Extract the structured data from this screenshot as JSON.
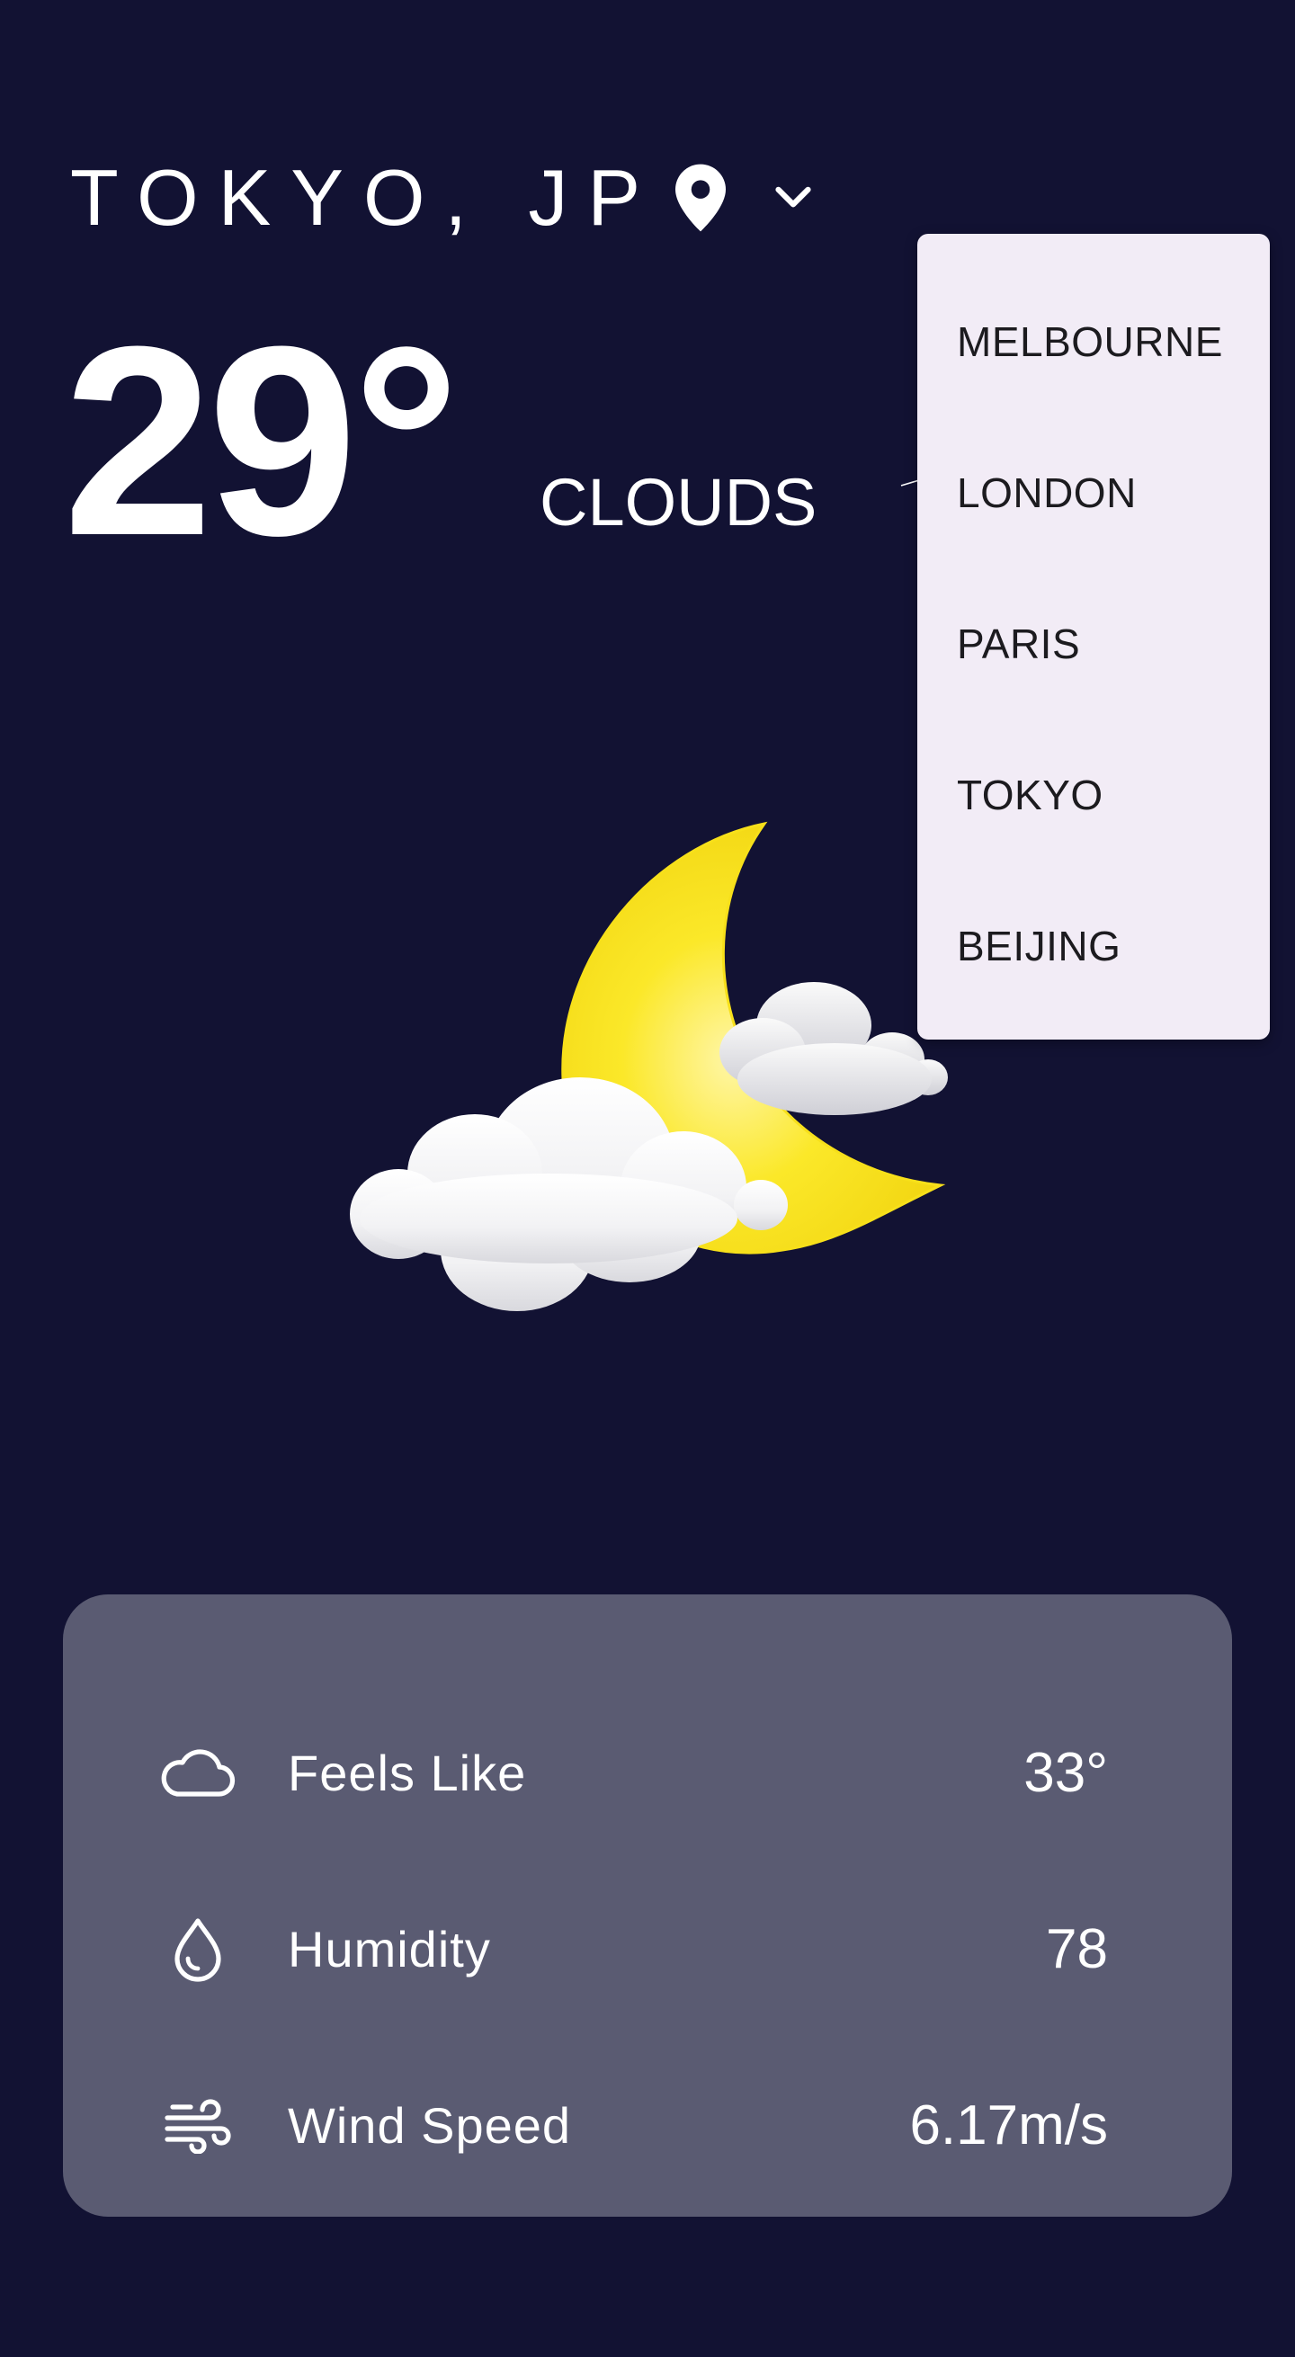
{
  "header": {
    "location": "TOKYO, JP",
    "pin_icon": "location-pin-icon",
    "dropdown_icon": "chevron-down-icon"
  },
  "current": {
    "temperature": "29°",
    "condition": "CLOUDS",
    "illustration": "moon-with-clouds"
  },
  "city_menu": {
    "items": [
      {
        "label": "MELBOURNE"
      },
      {
        "label": "LONDON"
      },
      {
        "label": "PARIS"
      },
      {
        "label": "TOKYO"
      },
      {
        "label": "BEIJING"
      }
    ]
  },
  "stats": {
    "rows": [
      {
        "icon": "cloud-icon",
        "label": "Feels Like",
        "value": "33°"
      },
      {
        "icon": "droplet-icon",
        "label": "Humidity",
        "value": "78"
      },
      {
        "icon": "wind-icon",
        "label": "Wind Speed",
        "value": "6.17m/s"
      }
    ]
  },
  "colors": {
    "background": "#121233",
    "card": "#5a5b72",
    "menu": "#f2ecf6",
    "moon": "#f7e31c",
    "text": "#ffffff"
  }
}
